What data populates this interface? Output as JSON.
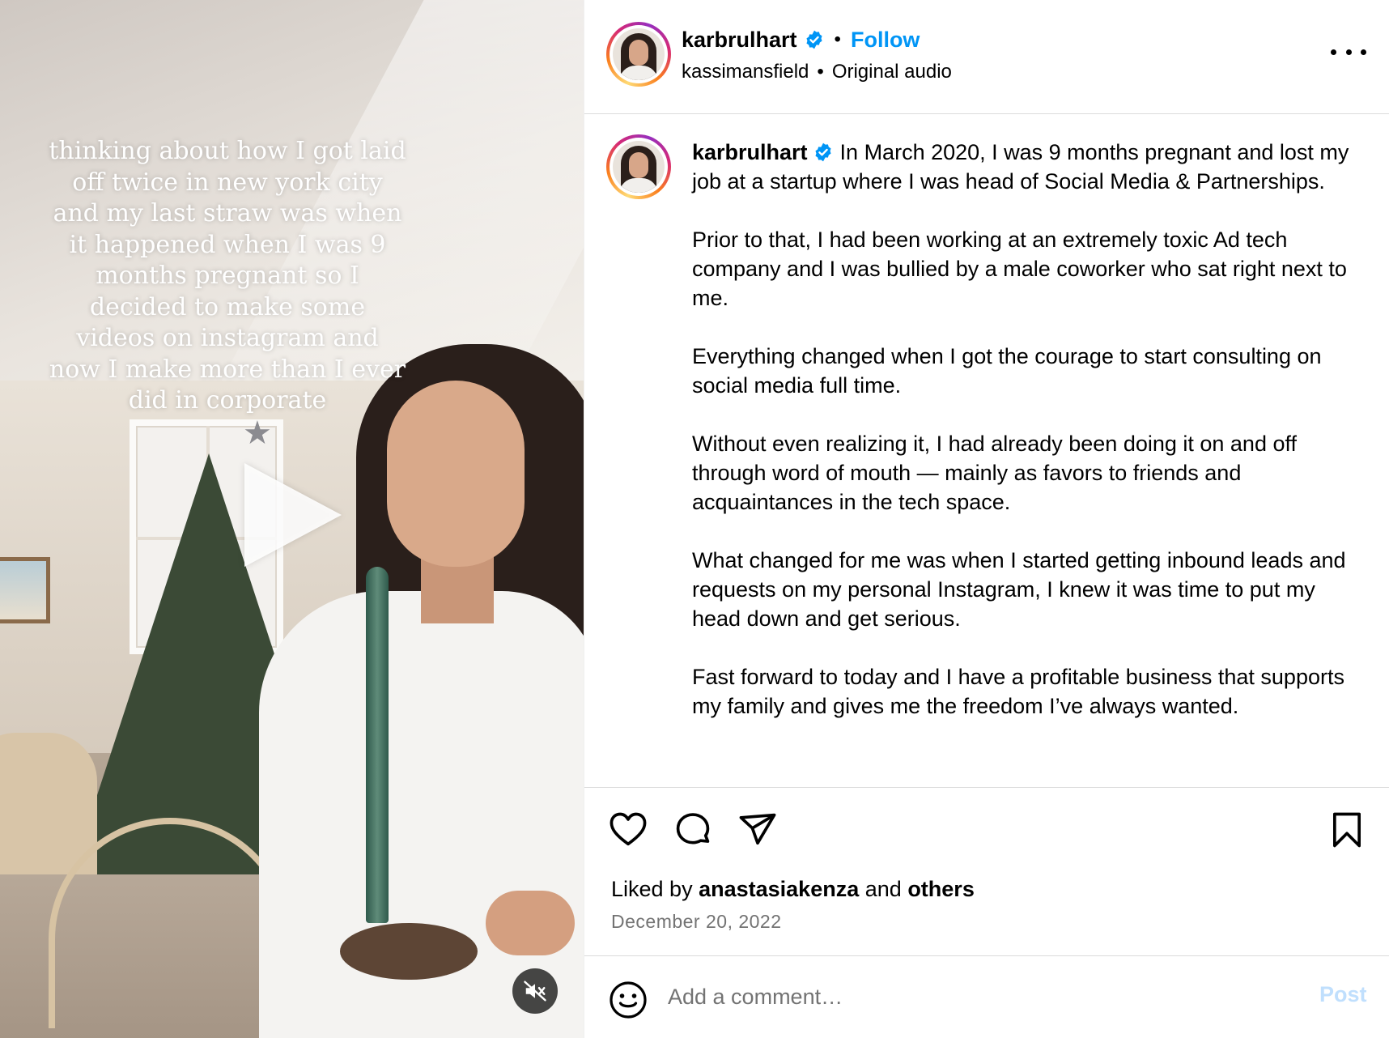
{
  "media": {
    "overlay_text": "thinking about how I got laid off twice in new york city and my last straw was when it happened when I was 9 months pregnant so I decided to make some videos on instagram and now I make more than I ever did in corporate",
    "play_icon": "play-icon",
    "mute_icon": "speaker-muted-icon"
  },
  "header": {
    "username": "karbrulhart",
    "verified_icon": "verified-badge-icon",
    "separator": "•",
    "follow_label": "Follow",
    "audio_author": "kassimansfield",
    "audio_separator": "•",
    "audio_title": "Original audio",
    "more_icon": "more-options-icon"
  },
  "caption": {
    "username": "karbrulhart",
    "paragraphs": [
      "In March 2020, I was 9 months pregnant and lost my job at a startup where I was head of Social Media & Partnerships.",
      "Prior to that, I had been working at an extremely toxic Ad tech company and I was bullied by a male coworker who sat right next to me.",
      "Everything changed when I got the courage to start consulting on social media full time.",
      "Without even realizing it, I had already been doing it on and off through word of mouth — mainly as favors to friends and acquaintances in the tech space.",
      "What changed for me was when I started getting inbound leads and requests on my personal Instagram, I knew it was time to put my head down and get serious.",
      "Fast forward to today and I have a profitable business that supports my family and gives me the freedom I’ve always wanted."
    ]
  },
  "actions": {
    "like_icon": "heart-icon",
    "comment_icon": "comment-bubble-icon",
    "share_icon": "paper-plane-icon",
    "save_icon": "bookmark-icon"
  },
  "likes": {
    "prefix": "Liked by",
    "user": "anastasiakenza",
    "connector": "and",
    "others": "others"
  },
  "date": "December 20, 2022",
  "comment_box": {
    "emoji_icon": "smiley-face-icon",
    "placeholder": "Add a comment…",
    "post_label": "Post"
  },
  "colors": {
    "accent": "#0095f6",
    "post_disabled": "#c0dffd",
    "secondary_text": "#737373",
    "divider": "#dbdbdb"
  }
}
